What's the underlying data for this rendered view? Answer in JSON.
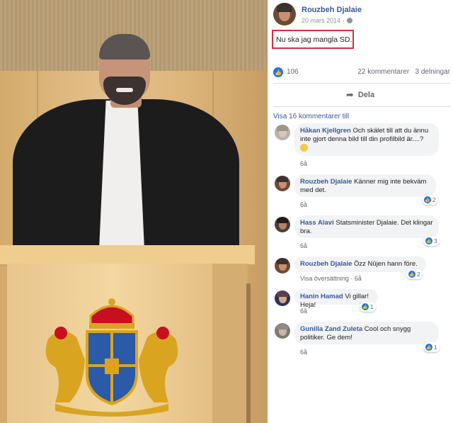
{
  "post": {
    "author": "Rouzbeh Djalaie",
    "date": "20 mars 2014",
    "date_sep": "·",
    "privacy_icon": "globe-icon",
    "text": "Nu ska jag mangla SD.",
    "highlight_color": "#d22f3f"
  },
  "stats": {
    "likes": "106",
    "comments": "22 kommentarer",
    "shares": "3 delningar"
  },
  "actions": {
    "share_label": "Dela",
    "share_icon": "share-arrow-icon"
  },
  "comments_section": {
    "more_label": "Visa 16 kommentarer till",
    "items": [
      {
        "name": "Håkan Kjellgren",
        "text": "Och skälet till att du ännu inte gjort denna bild till din profilbild är....?",
        "time": "6å",
        "reactions": ""
      },
      {
        "name": "Rouzbeh Djalaie",
        "text": "Känner mig inte bekväm med det.",
        "time": "6å",
        "reactions": "2"
      },
      {
        "name": "Hass Alavi",
        "text": "Statsminister Djalaie. Det klingar bra.",
        "time": "6å",
        "reactions": "3"
      },
      {
        "name": "Rouzbeh Djalaie",
        "text": "Özz Nûjen hann före.",
        "translate": "Visa översättning",
        "sep": "·",
        "time": "6å",
        "reactions": "2"
      },
      {
        "name": "Hanin Hamad",
        "text": "Vi gillar! Heja!",
        "time": "6å",
        "reactions": "1"
      },
      {
        "name": "Gunilla Zand Zuleta",
        "text": "Cool och snygg politiker. Ge dem!",
        "time": "6å",
        "reactions": "1"
      }
    ]
  },
  "colors": {
    "link_blue": "#385898",
    "like_blue": "#1877f2",
    "bubble_bg": "#f2f3f5",
    "muted": "#606770"
  }
}
